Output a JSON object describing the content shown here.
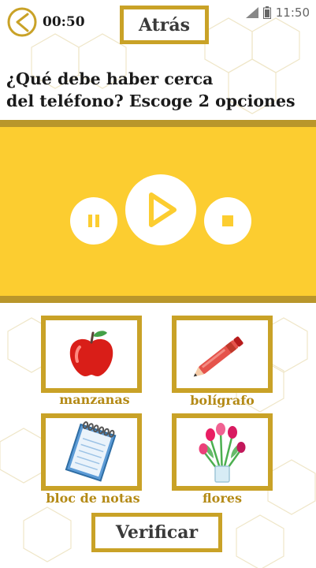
{
  "status_bar": {
    "time": "11:50",
    "icons": [
      "signal-icon",
      "battery-icon"
    ]
  },
  "timer": {
    "value": "00:50",
    "icon": "clock-icon"
  },
  "back_button": {
    "label": "Atrás"
  },
  "question": {
    "line1": "¿Qué debe haber cerca",
    "line2": "del teléfono? Escoge 2 opciones"
  },
  "player": {
    "controls": [
      "pause-icon",
      "play-icon",
      "stop-icon"
    ]
  },
  "options": [
    {
      "label": "manzanas",
      "icon": "apple-icon"
    },
    {
      "label": "bolígrafo",
      "icon": "pen-icon"
    },
    {
      "label": "bloc de notas",
      "icon": "notepad-icon"
    },
    {
      "label": "flores",
      "icon": "flowers-icon"
    }
  ],
  "verify_button": {
    "label": "Verificar"
  },
  "colors": {
    "gold": "#c9a227",
    "player_yellow": "#fccd30",
    "label_gold": "#b48a16"
  }
}
